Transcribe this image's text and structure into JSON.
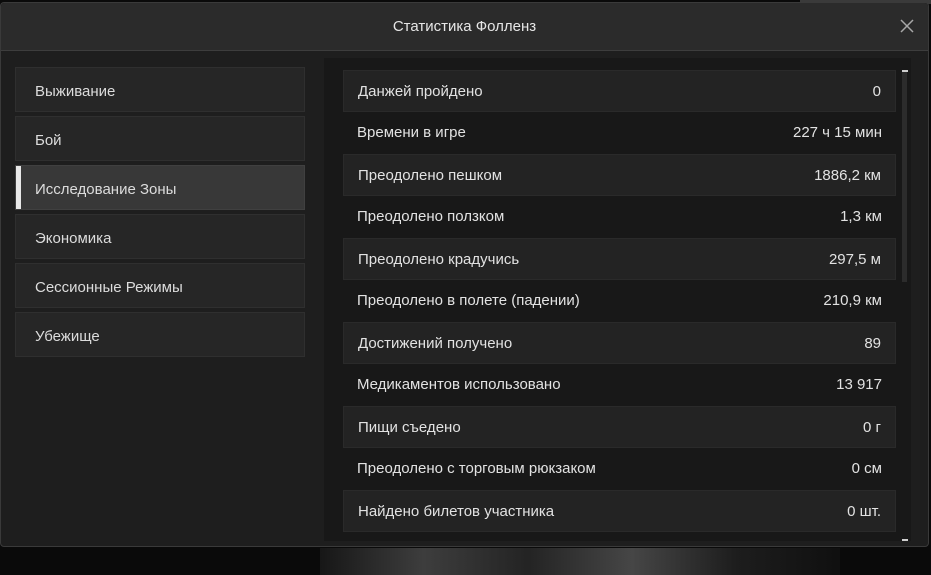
{
  "window": {
    "title": "Статистика Фолленз"
  },
  "icons": {
    "close": "close-icon"
  },
  "sidebar": {
    "items": [
      {
        "label": "Выживание",
        "active": false
      },
      {
        "label": "Бой",
        "active": false
      },
      {
        "label": "Исследование Зоны",
        "active": true
      },
      {
        "label": "Экономика",
        "active": false
      },
      {
        "label": "Сессионные Режимы",
        "active": false
      },
      {
        "label": "Убежище",
        "active": false
      }
    ]
  },
  "stats": {
    "rows": [
      {
        "label": "Данжей пройдено",
        "value": "0"
      },
      {
        "label": "Времени в игре",
        "value": "227 ч 15 мин"
      },
      {
        "label": "Преодолено пешком",
        "value": "1886,2 км"
      },
      {
        "label": "Преодолено ползком",
        "value": "1,3 км"
      },
      {
        "label": "Преодолено крадучись",
        "value": "297,5 м"
      },
      {
        "label": "Преодолено в полете (падении)",
        "value": "210,9 км"
      },
      {
        "label": "Достижений получено",
        "value": "89"
      },
      {
        "label": "Медикаментов использовано",
        "value": "13 917"
      },
      {
        "label": "Пищи съедено",
        "value": "0 г"
      },
      {
        "label": "Преодолено с торговым рюкзаком",
        "value": "0 см"
      },
      {
        "label": "Найдено билетов участника",
        "value": "0 шт."
      }
    ]
  },
  "colors": {
    "accent": "#e8e8e8",
    "panel": "#1e1e1e",
    "row": "#232323"
  }
}
